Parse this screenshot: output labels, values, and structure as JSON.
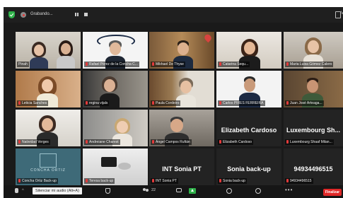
{
  "topbar": {
    "recording_label": "Grabando...",
    "view_label": "Vi"
  },
  "tiles": [
    {
      "name": "Pinah",
      "big_name": ""
    },
    {
      "name": "Rafael Pérez de la Concha C...",
      "big_name": ""
    },
    {
      "name": "Mikhael De Thyse",
      "big_name": ""
    },
    {
      "name": "Catarina Sequ...",
      "big_name": ""
    },
    {
      "name": "Maria Luisa Gómez Calero",
      "big_name": ""
    },
    {
      "name": "Leticia Sanches",
      "big_name": ""
    },
    {
      "name": "regina vijals",
      "big_name": ""
    },
    {
      "name": "Paula Cordeiro",
      "big_name": ""
    },
    {
      "name": "Carlos PIRES FERREIRA",
      "big_name": ""
    },
    {
      "name": "Juan José Arteaga...",
      "big_name": ""
    },
    {
      "name": "Natividad Verges",
      "big_name": ""
    },
    {
      "name": "Andreiane Charest",
      "big_name": ""
    },
    {
      "name": "Ángel Campos Rufián",
      "big_name": ""
    },
    {
      "name": "Elizabeth Cardoso",
      "big_name": "Elizabeth Cardoso"
    },
    {
      "name": "Luxembourg Shaaf Milan...",
      "big_name": "Luxembourg Sh..."
    },
    {
      "name": "Concha Ortiz Back-up",
      "big_name": ""
    },
    {
      "name": "Teresa back-up",
      "big_name": ""
    },
    {
      "name": "INT Sonia PT",
      "big_name": "INT Sonia PT"
    },
    {
      "name": "Sonia back-up",
      "big_name": "Sonia back-up"
    },
    {
      "name": "94934496515",
      "big_name": "94934496515"
    }
  ],
  "logo_text": "CONCHA ORTIZ",
  "bottombar": {
    "mic_tooltip": "Silenciar mi audio (Alt+A)",
    "participants_count": "22",
    "end_label": "Finalizar"
  },
  "colors": {
    "active_speaker": "#e8e14a",
    "mic_muted": "#e23b3b",
    "end_button": "#e02828",
    "share_button": "#2fb24a"
  }
}
